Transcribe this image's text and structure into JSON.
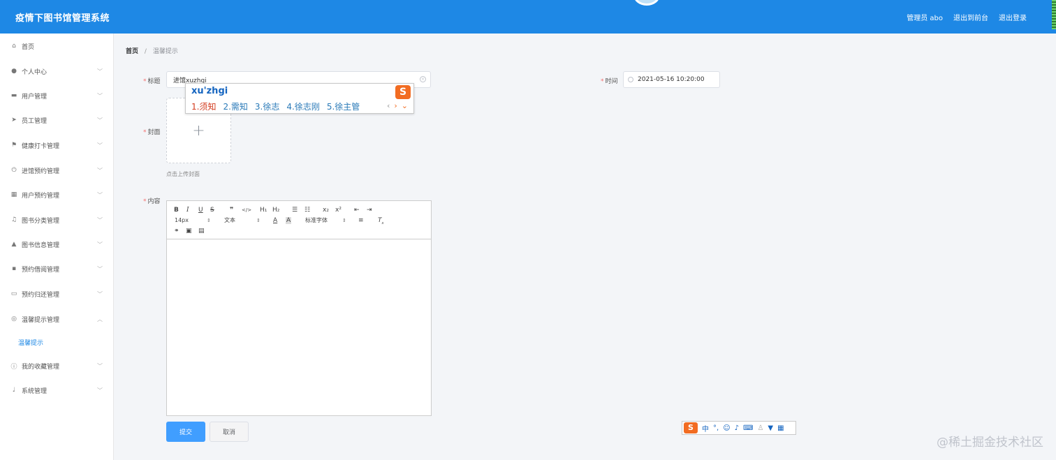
{
  "header": {
    "app_title": "疫情下图书馆管理系统",
    "admin_label": "管理员 abo",
    "to_front_label": "退出到前台",
    "logout_label": "退出登录"
  },
  "sidebar": {
    "items": [
      {
        "label": "首页",
        "icon": "home-icon"
      },
      {
        "label": "个人中心",
        "icon": "user-icon"
      },
      {
        "label": "用户管理",
        "icon": "ticket-icon"
      },
      {
        "label": "员工管理",
        "icon": "send-icon"
      },
      {
        "label": "健康打卡管理",
        "icon": "flag-icon"
      },
      {
        "label": "进馆预约管理",
        "icon": "power-icon"
      },
      {
        "label": "用户预约管理",
        "icon": "grid-icon"
      },
      {
        "label": "图书分类管理",
        "icon": "bell-off-icon"
      },
      {
        "label": "图书信息管理",
        "icon": "stamp-icon"
      },
      {
        "label": "预约借阅管理",
        "icon": "menu-grid-icon"
      },
      {
        "label": "预约归还管理",
        "icon": "chat-icon"
      },
      {
        "label": "温馨提示管理",
        "icon": "aim-icon"
      },
      {
        "label": "我的收藏管理",
        "icon": "info-icon"
      },
      {
        "label": "系统管理",
        "icon": "microphone-icon"
      }
    ],
    "active_sub_label": "温馨提示"
  },
  "breadcrumb": {
    "home": "首页",
    "separator": "/",
    "current": "温馨提示"
  },
  "form": {
    "title_label": "标题",
    "title_value": "进馆xuzhgi",
    "time_label": "时间",
    "time_value": "2021-05-16 10:20:00",
    "cover_label": "封面",
    "upload_plus": "+",
    "upload_tip": "点击上传封面",
    "content_label": "内容",
    "required_mark": "*",
    "submit_label": "提交",
    "cancel_label": "取消"
  },
  "editor": {
    "font_size": "14px",
    "header_select": "文本",
    "font_family": "标准字体"
  },
  "ime": {
    "pinyin": "xu'zhgi",
    "candidates": [
      "1.须知",
      "2.需知",
      "3.徐志",
      "4.徐志刚",
      "5.徐主管"
    ],
    "bar_lang": "中",
    "bar_punct": "°,"
  },
  "watermark": "@稀土掘金技术社区",
  "colors": {
    "header_bg": "#1e88e5",
    "primary_button": "#409eff",
    "required_star": "#f56c6c",
    "ime_logo": "#f26c22"
  }
}
